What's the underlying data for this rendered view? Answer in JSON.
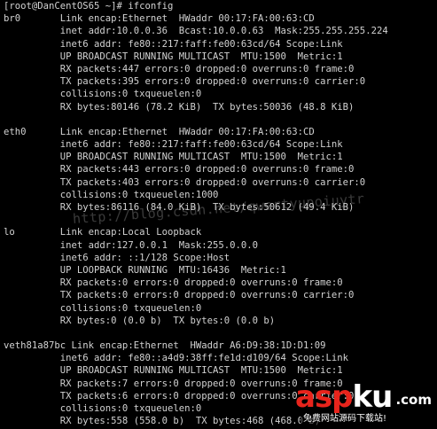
{
  "terminal": {
    "lines": [
      "[root@DanCentOS65 ~]# ifconfig",
      "br0       Link encap:Ethernet  HWaddr 00:17:FA:00:63:CD",
      "          inet addr:10.0.0.36  Bcast:10.0.0.63  Mask:255.255.255.224",
      "          inet6 addr: fe80::217:faff:fe00:63cd/64 Scope:Link",
      "          UP BROADCAST RUNNING MULTICAST  MTU:1500  Metric:1",
      "          RX packets:447 errors:0 dropped:0 overruns:0 frame:0",
      "          TX packets:395 errors:0 dropped:0 overruns:0 carrier:0",
      "          collisions:0 txqueuelen:0",
      "          RX bytes:80146 (78.2 KiB)  TX bytes:50036 (48.8 KiB)",
      "",
      "eth0      Link encap:Ethernet  HWaddr 00:17:FA:00:63:CD",
      "          inet6 addr: fe80::217:faff:fe00:63cd/64 Scope:Link",
      "          UP BROADCAST RUNNING MULTICAST  MTU:1500  Metric:1",
      "          RX packets:443 errors:0 dropped:0 overruns:0 frame:0",
      "          TX packets:403 errors:0 dropped:0 overruns:0 carrier:0",
      "          collisions:0 txqueuelen:1000",
      "          RX bytes:86116 (84.0 KiB)  TX bytes:50612 (49.4 KiB)",
      "",
      "lo        Link encap:Local Loopback",
      "          inet addr:127.0.0.1  Mask:255.0.0.0",
      "          inet6 addr: ::1/128 Scope:Host",
      "          UP LOOPBACK RUNNING  MTU:16436  Metric:1",
      "          RX packets:0 errors:0 dropped:0 overruns:0 frame:0",
      "          TX packets:0 errors:0 dropped:0 overruns:0 carrier:0",
      "          collisions:0 txqueuelen:0",
      "          RX bytes:0 (0.0 b)  TX bytes:0 (0.0 b)",
      "",
      "veth81a87bc Link encap:Ethernet  HWaddr A6:D9:38:1D:D1:09",
      "          inet6 addr: fe80::a4d9:38ff:fe1d:d109/64 Scope:Link",
      "          UP BROADCAST RUNNING MULTICAST  MTU:1500  Metric:1",
      "          RX packets:7 errors:0 dropped:0 overruns:0 frame:0",
      "          TX packets:6 errors:0 dropped:0 overruns:0 carrier:0",
      "          collisions:0 txqueuelen:0",
      "          RX bytes:558 (558.0 b)  TX bytes:468 (468.0 b)"
    ]
  },
  "watermark": {
    "url": "http://blog.csdn.net/qwertyupoiuytr"
  },
  "logo": {
    "word_red": "asp",
    "word_white": "ku",
    "suffix": ".com",
    "tagline": "免费网站源码下载站!"
  },
  "colors": {
    "background": "#000000",
    "text": "#d2d2d2",
    "logo_red": "#e8241c"
  }
}
